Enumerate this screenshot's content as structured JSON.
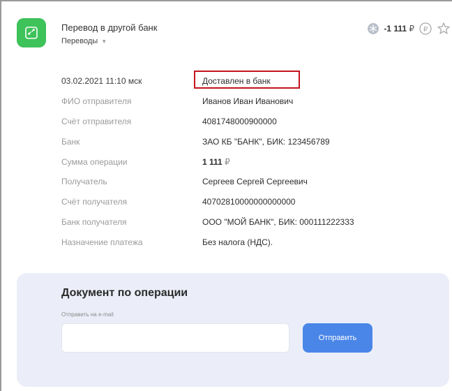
{
  "header": {
    "title": "Перевод в другой банк",
    "category": "Переводы",
    "amount": "-1 111",
    "currency": "₽"
  },
  "details": [
    {
      "label": "03.02.2021 11:10 мск",
      "value": "Доставлен в банк",
      "highlight": true
    },
    {
      "label": "ФИО отправителя",
      "value": "Иванов Иван Иванович"
    },
    {
      "label": "Счёт отправителя",
      "value": "4081748000900000"
    },
    {
      "label": "Банк",
      "value": "ЗАО КБ \"БАНК\", БИК: 123456789"
    },
    {
      "label": "Сумма операции",
      "value": "1 111",
      "currency": "₽"
    },
    {
      "label": "Получатель",
      "value": "Сергеев Сергей Сергеевич"
    },
    {
      "label": "Счёт получателя",
      "value": "40702810000000000000"
    },
    {
      "label": "Банк получателя",
      "value": "ООО \"МОЙ БАНК\", БИК: 000111222333"
    },
    {
      "label": "Назначение платежа",
      "value": "Без налога (НДС)."
    }
  ],
  "document": {
    "title": "Документ по операции",
    "email_label": "Отправить на e-mail",
    "email_value": "",
    "send_label": "Отправить"
  },
  "colors": {
    "brand_green": "#3ec25a",
    "accent_blue": "#4a86e8",
    "highlight_red": "#c4141d",
    "card_bg": "#ebeef8"
  },
  "icons": {
    "app": "transfer-arrows-icon",
    "category_toggle": "chevron-down-icon",
    "amount_badge": "snowflake-badge-icon",
    "cashback": "ruble-cashback-icon",
    "favorite": "star-icon"
  }
}
